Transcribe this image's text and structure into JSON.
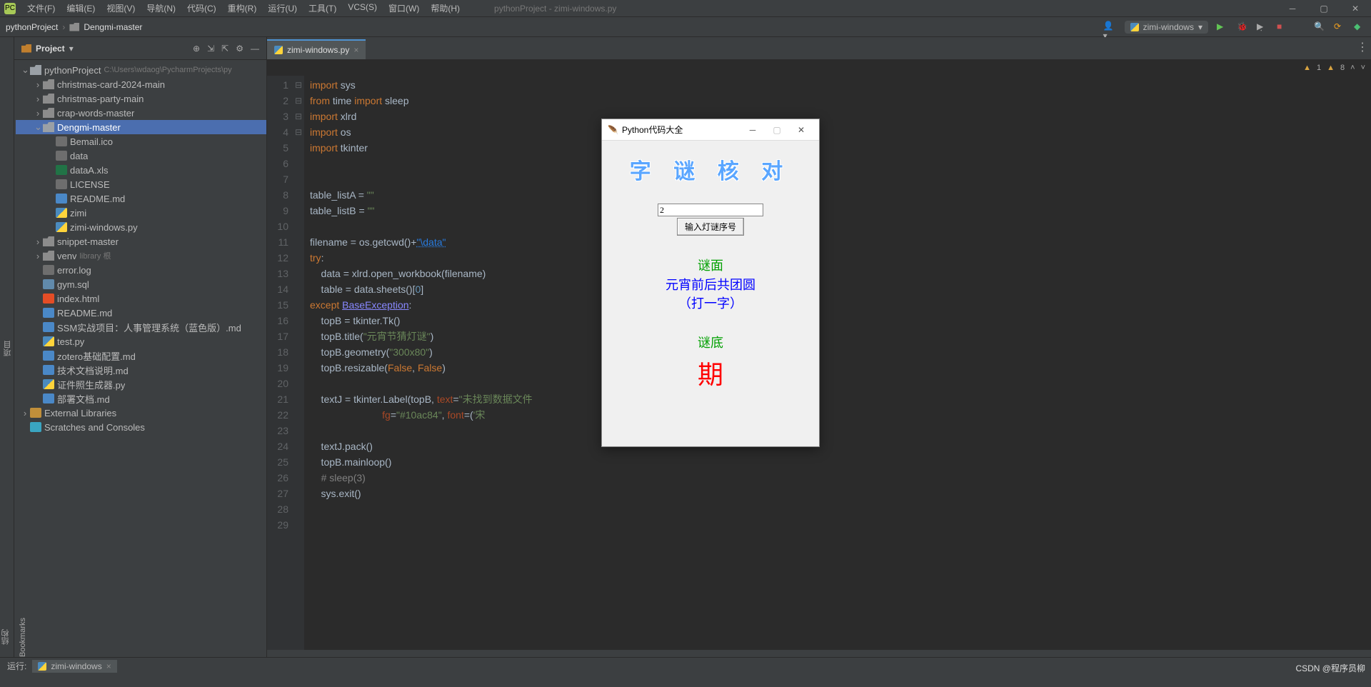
{
  "window": {
    "title": "pythonProject - zimi-windows.py",
    "menus": [
      "文件(F)",
      "编辑(E)",
      "视图(V)",
      "导航(N)",
      "代码(C)",
      "重构(R)",
      "运行(U)",
      "工具(T)",
      "VCS(S)",
      "窗口(W)",
      "帮助(H)"
    ]
  },
  "breadcrumb": {
    "items": [
      "pythonProject",
      "Dengmi-master"
    ]
  },
  "run_config": {
    "label": "zimi-windows"
  },
  "project": {
    "panel_title": "Project",
    "root": {
      "name": "pythonProject",
      "path": "C:\\Users\\wdaog\\PycharmProjects\\py"
    },
    "tree": [
      {
        "depth": 0,
        "twisty": "v",
        "icon": "folder-open",
        "label": "pythonProject",
        "dim": "C:\\Users\\wdaog\\PycharmProjects\\py",
        "interact": true
      },
      {
        "depth": 1,
        "twisty": ">",
        "icon": "folder",
        "label": "christmas-card-2024-main",
        "interact": true
      },
      {
        "depth": 1,
        "twisty": ">",
        "icon": "folder",
        "label": "christmas-party-main",
        "interact": true
      },
      {
        "depth": 1,
        "twisty": ">",
        "icon": "folder",
        "label": "crap-words-master",
        "interact": true
      },
      {
        "depth": 1,
        "twisty": "v",
        "icon": "folder-open",
        "label": "Dengmi-master",
        "interact": true,
        "selected": true
      },
      {
        "depth": 2,
        "twisty": "",
        "icon": "txt",
        "label": "Bemail.ico",
        "interact": true
      },
      {
        "depth": 2,
        "twisty": "",
        "icon": "txt",
        "label": "data",
        "interact": true
      },
      {
        "depth": 2,
        "twisty": "",
        "icon": "xls",
        "label": "dataA.xls",
        "interact": true
      },
      {
        "depth": 2,
        "twisty": "",
        "icon": "txt",
        "label": "LICENSE",
        "interact": true
      },
      {
        "depth": 2,
        "twisty": "",
        "icon": "md",
        "label": "README.md",
        "interact": true
      },
      {
        "depth": 2,
        "twisty": "",
        "icon": "py",
        "label": "zimi",
        "interact": true
      },
      {
        "depth": 2,
        "twisty": "",
        "icon": "py",
        "label": "zimi-windows.py",
        "interact": true
      },
      {
        "depth": 1,
        "twisty": ">",
        "icon": "folder",
        "label": "snippet-master",
        "interact": true
      },
      {
        "depth": 1,
        "twisty": ">",
        "icon": "folder",
        "label": "venv",
        "dim": "library 根",
        "interact": true
      },
      {
        "depth": 1,
        "twisty": "",
        "icon": "txt",
        "label": "error.log",
        "interact": true
      },
      {
        "depth": 1,
        "twisty": "",
        "icon": "sql",
        "label": "gym.sql",
        "interact": true
      },
      {
        "depth": 1,
        "twisty": "",
        "icon": "html",
        "label": "index.html",
        "interact": true
      },
      {
        "depth": 1,
        "twisty": "",
        "icon": "md",
        "label": "README.md",
        "interact": true
      },
      {
        "depth": 1,
        "twisty": "",
        "icon": "md",
        "label": "SSM实战项目：人事管理系统（蓝色版）.md",
        "interact": true
      },
      {
        "depth": 1,
        "twisty": "",
        "icon": "py",
        "label": "test.py",
        "interact": true
      },
      {
        "depth": 1,
        "twisty": "",
        "icon": "md",
        "label": "zotero基础配置.md",
        "interact": true
      },
      {
        "depth": 1,
        "twisty": "",
        "icon": "md",
        "label": "技术文档说明.md",
        "interact": true
      },
      {
        "depth": 1,
        "twisty": "",
        "icon": "py",
        "label": "证件照生成器.py",
        "interact": true
      },
      {
        "depth": 1,
        "twisty": "",
        "icon": "md",
        "label": "部署文档.md",
        "interact": true
      },
      {
        "depth": 0,
        "twisty": ">",
        "icon": "lib",
        "label": "External Libraries",
        "interact": true
      },
      {
        "depth": 0,
        "twisty": "",
        "icon": "scratch",
        "label": "Scratches and Consoles",
        "interact": true
      }
    ]
  },
  "left_gutter": {
    "tabs": [
      "项目"
    ],
    "bottom_tabs": [
      "结构",
      "Bookmarks"
    ]
  },
  "editor": {
    "tab_label": "zimi-windows.py",
    "inspections": {
      "warn1_count": "1",
      "warn2_count": "8"
    },
    "line_count": 29,
    "fold_marks": {
      "1": "⊟",
      "5": "⊟",
      "12": "⊟",
      "15": "⊟"
    }
  },
  "runbar": {
    "label": "运行:",
    "tab": "zimi-windows"
  },
  "watermark": "CSDN @程序员柳",
  "popup": {
    "title": "Python代码大全",
    "heading": "字 谜 核 对",
    "input_value": "2",
    "button": "输入灯谜序号",
    "section1": "谜面",
    "riddle_line1": "元宵前后共团圆",
    "riddle_line2": "（打一字）",
    "section2": "谜底",
    "answer": "期"
  },
  "code_lines": [
    {
      "n": 1,
      "html": "<span class='kw'>import</span> sys"
    },
    {
      "n": 2,
      "html": "<span class='kw'>from</span> time <span class='kw'>import</span> sleep"
    },
    {
      "n": 3,
      "html": "<span class='kw'>import</span> xlrd"
    },
    {
      "n": 4,
      "html": "<span class='kw'>import</span> os"
    },
    {
      "n": 5,
      "html": "<span class='kw'>import</span> tkinter"
    },
    {
      "n": 6,
      "html": ""
    },
    {
      "n": 7,
      "html": ""
    },
    {
      "n": 8,
      "html": "table_listA = <span class='str'>\"\"</span>"
    },
    {
      "n": 9,
      "html": "table_listB = <span class='str'>\"\"</span>"
    },
    {
      "n": 10,
      "html": ""
    },
    {
      "n": 11,
      "html": "filename = os.getcwd()+<span class='str url'>\"\\data\"</span>"
    },
    {
      "n": 12,
      "html": "<span class='kw'>try</span>:"
    },
    {
      "n": 13,
      "html": "    data = xlrd.open_workbook(filename)"
    },
    {
      "n": 14,
      "html": "    table = data.sheets()[<span class='num'>0</span>]"
    },
    {
      "n": 15,
      "html": "<span class='kw'>except</span> <span class='err'>BaseException</span>:"
    },
    {
      "n": 16,
      "html": "    topB = tkinter.Tk()"
    },
    {
      "n": 17,
      "html": "    topB.title(<span class='str'>\"元宵节猜灯谜\"</span>)"
    },
    {
      "n": 18,
      "html": "    topB.geometry(<span class='str'>\"300x80\"</span>)"
    },
    {
      "n": 19,
      "html": "    topB.resizable(<span class='kw'>False</span>, <span class='kw'>False</span>)"
    },
    {
      "n": 20,
      "html": ""
    },
    {
      "n": 21,
      "html": "    textJ = tkinter.Label(topB, <span class='arg'>text</span>=<span class='str'>\"未找到数据文件</span>"
    },
    {
      "n": 22,
      "html": "                          <span class='arg'>fg</span>=<span class='str'>\"#10ac84\"</span>, <span class='arg'>font</span>=(<span class='str'>'宋</span>"
    },
    {
      "n": 23,
      "html": ""
    },
    {
      "n": 24,
      "html": "    textJ.pack()"
    },
    {
      "n": 25,
      "html": "    topB.mainloop()"
    },
    {
      "n": 26,
      "html": "    <span class='cm'># sleep(3)</span>"
    },
    {
      "n": 27,
      "html": "    sys.exit()"
    },
    {
      "n": 28,
      "html": ""
    },
    {
      "n": 29,
      "html": ""
    }
  ]
}
